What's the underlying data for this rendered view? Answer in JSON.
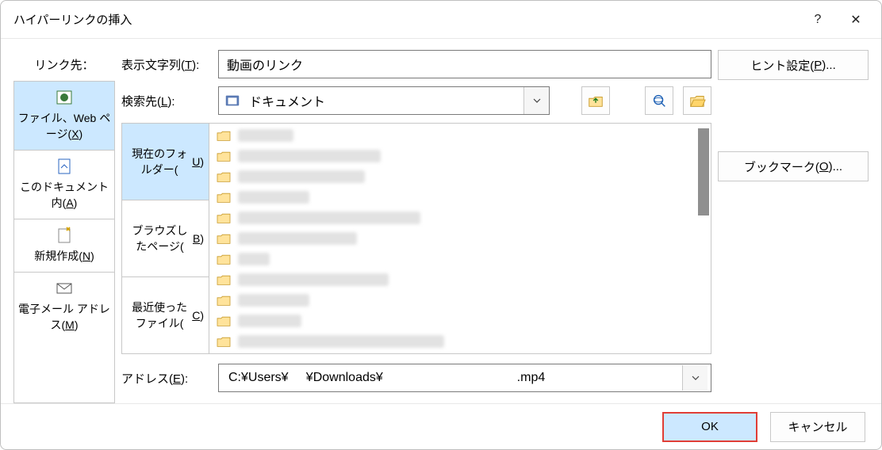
{
  "dialog": {
    "title": "ハイパーリンクの挿入",
    "help_symbol": "?",
    "close_symbol": "✕"
  },
  "left": {
    "caption": "リンク先：",
    "items": [
      {
        "label": "ファイル、Web ページ(X)",
        "key": "X",
        "selected": true
      },
      {
        "label": "このドキュメント内(A)",
        "key": "A",
        "selected": false
      },
      {
        "label": "新規作成(N)",
        "key": "N",
        "selected": false
      },
      {
        "label": "電子メール アドレス(M)",
        "key": "M",
        "selected": false
      }
    ]
  },
  "display_text": {
    "label": "表示文字列(T):",
    "value": "動画のリンク"
  },
  "search": {
    "label": "検索先(L):",
    "selected": "ドキュメント"
  },
  "toolbar_icons": {
    "up": "up-one-level-icon",
    "web": "browse-web-icon",
    "open": "browse-file-icon"
  },
  "browser_tabs": [
    {
      "label": "現在のフォルダー(U)",
      "selected": true
    },
    {
      "label": "ブラウズしたページ(B)",
      "selected": false
    },
    {
      "label": "最近使ったファイル(C)",
      "selected": false
    }
  ],
  "file_rows": 11,
  "address": {
    "label": "アドレス(E):",
    "value": "C:¥Users¥     ¥Downloads¥                                      .mp4"
  },
  "sidebar_right": {
    "hint": "ヒント設定(P)...",
    "bookmark": "ブックマーク(O)..."
  },
  "footer": {
    "ok": "OK",
    "cancel": "キャンセル"
  }
}
